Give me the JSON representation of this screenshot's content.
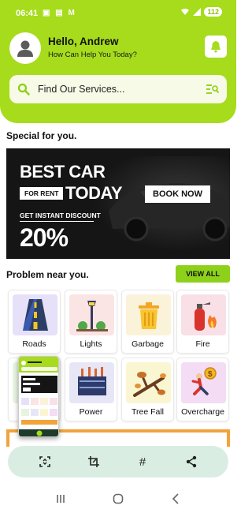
{
  "status_bar": {
    "time": "06:41",
    "left_icons": "▣ ▤ M",
    "battery": "112"
  },
  "header": {
    "greeting": "Hello, Andrew",
    "subtitle": "How Can Help You Today?",
    "accent_color": "#a6dc1c"
  },
  "search": {
    "placeholder": "Find Our Services..."
  },
  "special": {
    "title": "Special for you.",
    "banner": {
      "line1": "BEST CAR",
      "tag": "FOR RENT",
      "line2": "TODAY",
      "cta": "BOOK NOW",
      "discount_label": "GET INSTANT DISCOUNT",
      "discount_value": "20%"
    }
  },
  "problems": {
    "title": "Problem near you.",
    "view_all": "VIEW ALL",
    "items": [
      {
        "label": "Roads",
        "bg": "#e6e0f8",
        "icon": "road-icon"
      },
      {
        "label": "Lights",
        "bg": "#fbe4e4",
        "icon": "street-light-icon"
      },
      {
        "label": "Garbage",
        "bg": "#fbf2da",
        "icon": "garbage-bin-icon"
      },
      {
        "label": "Fire",
        "bg": "#f8e0e6",
        "icon": "fire-extinguisher-icon"
      },
      {
        "label": "",
        "bg": "#e6f4e0",
        "icon": "hidden-icon"
      },
      {
        "label": "Power",
        "bg": "#e7e6f7",
        "icon": "power-tower-icon"
      },
      {
        "label": "Tree Fall",
        "bg": "#faf6d2",
        "icon": "tree-fall-icon"
      },
      {
        "label": "Overcharge",
        "bg": "#f4dcf4",
        "icon": "overcharge-icon"
      }
    ]
  },
  "toolbar": {
    "items": [
      "scroll-capture-icon",
      "crop-icon",
      "hashtag-icon",
      "share-icon"
    ],
    "hash": "#"
  }
}
